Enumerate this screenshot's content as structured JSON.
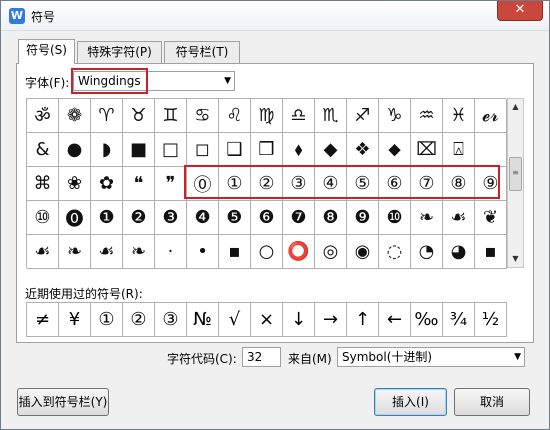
{
  "window": {
    "title": "符号",
    "app_icon_letter": "W",
    "close_glyph": "✕"
  },
  "tabs": [
    {
      "label": "符号(S)",
      "active": true
    },
    {
      "label": "特殊字符(P)",
      "active": false
    },
    {
      "label": "符号栏(T)",
      "active": false
    }
  ],
  "font": {
    "label": "字体(F):",
    "value": "Wingdings",
    "arrow": "▼"
  },
  "symbol_grid": [
    [
      "ॐ",
      "❁",
      "♈",
      "♉",
      "♊",
      "♋",
      "♌",
      "♍",
      "♎",
      "♏",
      "♐",
      "♑",
      "♒",
      "♓",
      "𝓮𝓻"
    ],
    [
      "&",
      "●",
      "◗",
      "■",
      "□",
      "◻",
      "❑",
      "❒",
      "⬧",
      "◆",
      "❖",
      "⬥",
      "⌧",
      "⍓",
      ""
    ],
    [
      "⌘",
      "❀",
      "✿",
      "❝",
      "❞",
      "⓪",
      "①",
      "②",
      "③",
      "④",
      "⑤",
      "⑥",
      "⑦",
      "⑧",
      "⑨"
    ],
    [
      "⑩",
      "⓿",
      "❶",
      "❷",
      "❸",
      "❹",
      "❺",
      "❻",
      "❼",
      "❽",
      "❾",
      "❿",
      "❧",
      "☙",
      "❦"
    ],
    [
      "☙",
      "❧",
      "☙",
      "❧",
      "·",
      "•",
      "▪",
      "○",
      "⭕",
      "◎",
      "◉",
      "◌",
      "◔",
      "◕",
      "▪"
    ]
  ],
  "scrollbar": {
    "up": "▲",
    "down": "▼",
    "thumb": "≡"
  },
  "recent": {
    "label": "近期使用过的符号(R):",
    "symbols": [
      "≠",
      "¥",
      "①",
      "②",
      "③",
      "№",
      "√",
      "×",
      "↓",
      "→",
      "↑",
      "←",
      "‰",
      "¾",
      "½"
    ]
  },
  "char_code": {
    "label": "字符代码(C):",
    "value": "32"
  },
  "from": {
    "label": "来自(M)",
    "value": "Symbol(十进制)",
    "arrow": "▼"
  },
  "buttons": {
    "insert_to_bar": "插入到符号栏(Y)",
    "insert": "插入(I)",
    "cancel": "取消"
  }
}
